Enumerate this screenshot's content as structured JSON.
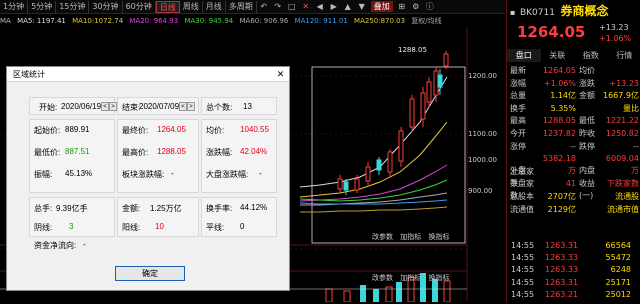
{
  "periods": [
    "1分钟",
    "5分钟",
    "15分钟",
    "30分钟",
    "60分钟",
    "日线",
    "周线",
    "月线",
    "多周期"
  ],
  "toolbar": {
    "overlay": "叠加",
    "more": "更多"
  },
  "ma": {
    "name": "MA",
    "ma5": "MA5: 1197.41",
    "ma10": "MA10:1072.74",
    "ma20": "MA20: 964.93",
    "ma30": "MA30: 945.94",
    "ma60": "MA60: 906.96",
    "ma120": "MA120: 911.01",
    "ma250": "MA250:870.03",
    "tail": "复权/均线"
  },
  "chart": {
    "peak_label": "1288.05",
    "y_ticks": [
      "1200.00",
      "1100.00",
      "1000.00",
      "900.00"
    ],
    "bottom_tabs": [
      "改参数",
      "加指标",
      "换指标"
    ],
    "bottom_tabs2": [
      "改参数",
      "加指标",
      "换指标"
    ]
  },
  "right": {
    "code": "BK0711",
    "name": "券商概念",
    "price": "1264.05",
    "chg": "+13.23",
    "pct": "+1.06%",
    "tabs": [
      "盘口",
      "关联",
      "指数",
      "行情"
    ],
    "rows": [
      [
        "最新",
        "1264.05",
        "均价",
        ""
      ],
      [
        "涨幅",
        "+1.06%",
        "涨跌",
        "+13.23"
      ],
      [
        "总量",
        "1.14亿",
        "金额",
        "1667.9亿"
      ],
      [
        "换手",
        "5.35%",
        "",
        "量比"
      ],
      [
        "最高",
        "1288.05",
        "最低",
        "1221.22"
      ],
      [
        "今开",
        "1237.82",
        "昨收",
        "1250.82"
      ],
      [
        "涨停",
        "--",
        "跌停",
        "--"
      ],
      [
        "外盘",
        "5382.18万",
        "内盘",
        "6009.04万"
      ],
      [
        "上涨家数",
        "41",
        "",
        "下跌家数"
      ],
      [
        "平盘家数",
        "",
        "收益(一)",
        ""
      ],
      [
        "总股本",
        "2707亿",
        "",
        "流通股"
      ],
      [
        "流通值",
        "2129亿",
        "",
        "流通市值"
      ]
    ],
    "ticks": [
      [
        "14:55",
        "1263.31",
        "66564"
      ],
      [
        "14:55",
        "1263.33",
        "55472"
      ],
      [
        "14:55",
        "1263.33",
        "6248"
      ],
      [
        "14:55",
        "1263.31",
        "25171"
      ],
      [
        "14:55",
        "1263.21",
        "25012"
      ]
    ]
  },
  "dialog": {
    "title": "区域统计",
    "start_label": "开始:",
    "start_value": "2020/06/19",
    "end_label": "结束:",
    "end_value": "2020/07/09",
    "count_label": "总个数:",
    "count_value": "13",
    "open_label": "起始价:",
    "open_value": "889.91",
    "close_label": "最终价:",
    "close_value": "1264.05",
    "avg_label": "均价:",
    "avg_value": "1040.55",
    "low_label": "最低价:",
    "low_value": "887.51",
    "high_label": "最高价:",
    "high_value": "1288.05",
    "chg_label": "涨跌幅:",
    "chg_value": "42.04%",
    "amp_label": "振幅:",
    "amp_value": "45.13%",
    "sector_amp_label": "板块涨跌幅:",
    "sector_amp_value": "-",
    "market_amp_label": "大盘涨跌幅:",
    "market_amp_value": "-",
    "vol_label": "总手:",
    "vol_value": "9.39亿手",
    "amt_label": "金额:",
    "amt_value": "1.25万亿",
    "turn_label": "换手率:",
    "turn_value": "44.12%",
    "yin_label": "阴线:",
    "yin_value": "3",
    "yang_label": "阳线:",
    "yang_value": "10",
    "flat_label": "平线:",
    "flat_value": "0",
    "flow_label": "资金净流向:",
    "flow_value": "-",
    "ok": "确定"
  }
}
